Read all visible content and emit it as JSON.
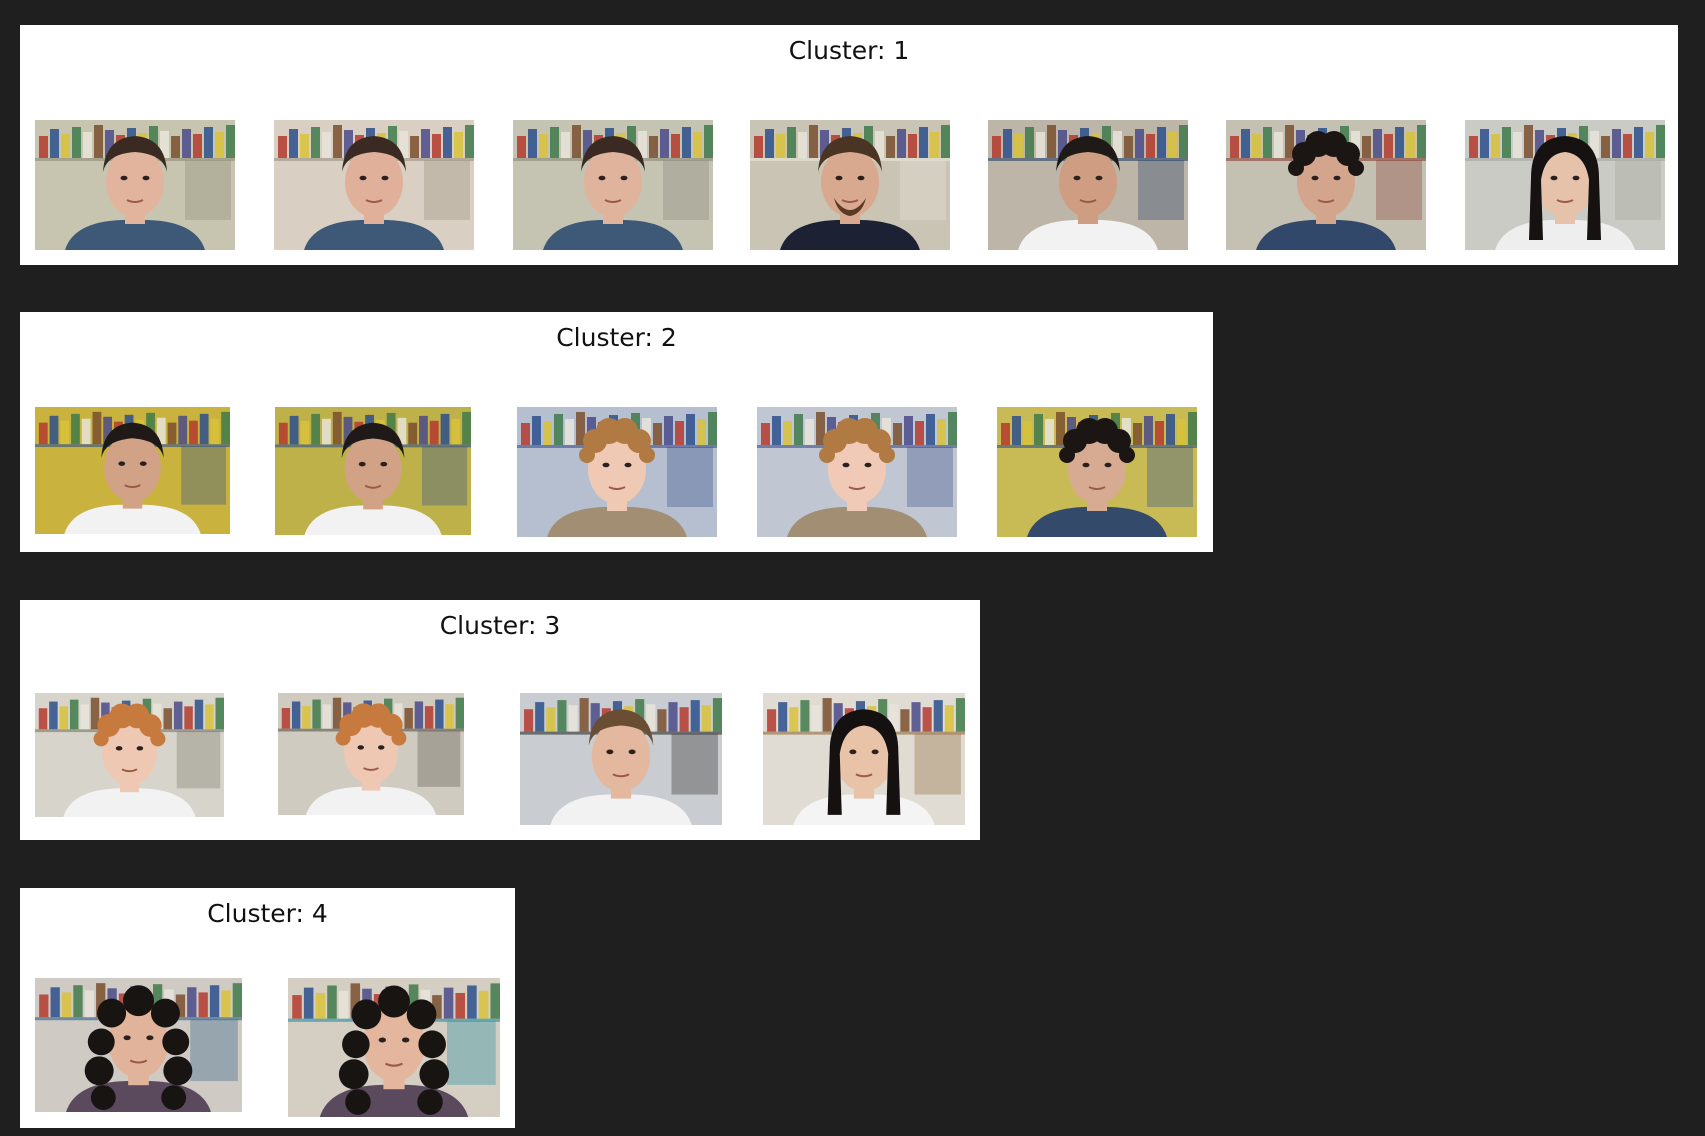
{
  "clusters": [
    {
      "title": "Cluster: 1",
      "faces": [
        {
          "skin": "#e2b49d",
          "hair": "#3a2a22",
          "shirt": "#3e5877",
          "bg": "#c7c5b0",
          "accent": "#8f8b78",
          "hairstyle": "short",
          "beard": false
        },
        {
          "skin": "#e0b09a",
          "hair": "#3a2a22",
          "shirt": "#3e5877",
          "bg": "#d9cfc2",
          "accent": "#9c8f80",
          "hairstyle": "short",
          "beard": false
        },
        {
          "skin": "#dfb39c",
          "hair": "#3a2a22",
          "shirt": "#3e5877",
          "bg": "#c5c3b2",
          "accent": "#8a8878",
          "hairstyle": "short",
          "beard": false
        },
        {
          "skin": "#d9a98f",
          "hair": "#4a3423",
          "shirt": "#1c2234",
          "bg": "#c9c4b3",
          "accent": "#e8e6dc",
          "hairstyle": "short",
          "beard": true
        },
        {
          "skin": "#cf9e82",
          "hair": "#1f1a17",
          "shirt": "#f2f2f2",
          "bg": "#bdb6a8",
          "accent": "#27436b",
          "hairstyle": "short",
          "beard": false
        },
        {
          "skin": "#d3a58d",
          "hair": "#1b1613",
          "shirt": "#32486a",
          "bg": "#c4c0b2",
          "accent": "#8c4136",
          "hairstyle": "curly",
          "beard": false
        },
        {
          "skin": "#e6c2aa",
          "hair": "#151211",
          "shirt": "#eeeeee",
          "bg": "#c9cbc4",
          "accent": "#a3a69f",
          "hairstyle": "long",
          "beard": false
        }
      ]
    },
    {
      "title": "Cluster: 2",
      "faces": [
        {
          "skin": "#d2a287",
          "hair": "#1f1a17",
          "shirt": "#f2f2f2",
          "bg": "#c9b23e",
          "accent": "#2c4f8f",
          "hairstyle": "short",
          "beard": false
        },
        {
          "skin": "#d2a287",
          "hair": "#1f1a17",
          "shirt": "#f2f2f2",
          "bg": "#bfb14a",
          "accent": "#2c4f8f",
          "hairstyle": "short",
          "beard": false
        },
        {
          "skin": "#efc9b4",
          "hair": "#b07a42",
          "shirt": "#a28e72",
          "bg": "#b6bfd0",
          "accent": "#3a4f8c",
          "hairstyle": "curly",
          "beard": false
        },
        {
          "skin": "#f0cab6",
          "hair": "#b07a42",
          "shirt": "#a28e72",
          "bg": "#c0c6d2",
          "accent": "#3a4f8c",
          "hairstyle": "curly",
          "beard": false
        },
        {
          "skin": "#d7ab92",
          "hair": "#1b1613",
          "shirt": "#334a6a",
          "bg": "#c8bb55",
          "accent": "#2c4f8f",
          "hairstyle": "curly",
          "beard": false
        }
      ]
    },
    {
      "title": "Cluster: 3",
      "faces": [
        {
          "skin": "#efc8b3",
          "hair": "#c77a3e",
          "shirt": "#f2f2f2",
          "bg": "#d6d4cb",
          "accent": "#7a7566",
          "hairstyle": "curly",
          "beard": false
        },
        {
          "skin": "#efc8b3",
          "hair": "#c77a3e",
          "shirt": "#f2f2f2",
          "bg": "#cfcbc0",
          "accent": "#5a554a",
          "hairstyle": "curly",
          "beard": false
        },
        {
          "skin": "#e4b89e",
          "hair": "#6a4e33",
          "shirt": "#f2f2f2",
          "bg": "#c9ccd0",
          "accent": "#2b2b2b",
          "hairstyle": "short",
          "beard": false
        },
        {
          "skin": "#e9c3a8",
          "hair": "#141110",
          "shirt": "#f4f4f4",
          "bg": "#e0dcd4",
          "accent": "#8e6a3a",
          "hairstyle": "long",
          "beard": false
        }
      ]
    },
    {
      "title": "Cluster: 4",
      "faces": [
        {
          "skin": "#e2b39b",
          "hair": "#181412",
          "shirt": "#5b4a5e",
          "bg": "#cfcbc4",
          "accent": "#2f5f87",
          "hairstyle": "curlylong",
          "beard": false
        },
        {
          "skin": "#e4b69d",
          "hair": "#181412",
          "shirt": "#5b4a5e",
          "bg": "#d4cec3",
          "accent": "#1f8fa0",
          "hairstyle": "curlylong",
          "beard": false
        }
      ]
    }
  ]
}
